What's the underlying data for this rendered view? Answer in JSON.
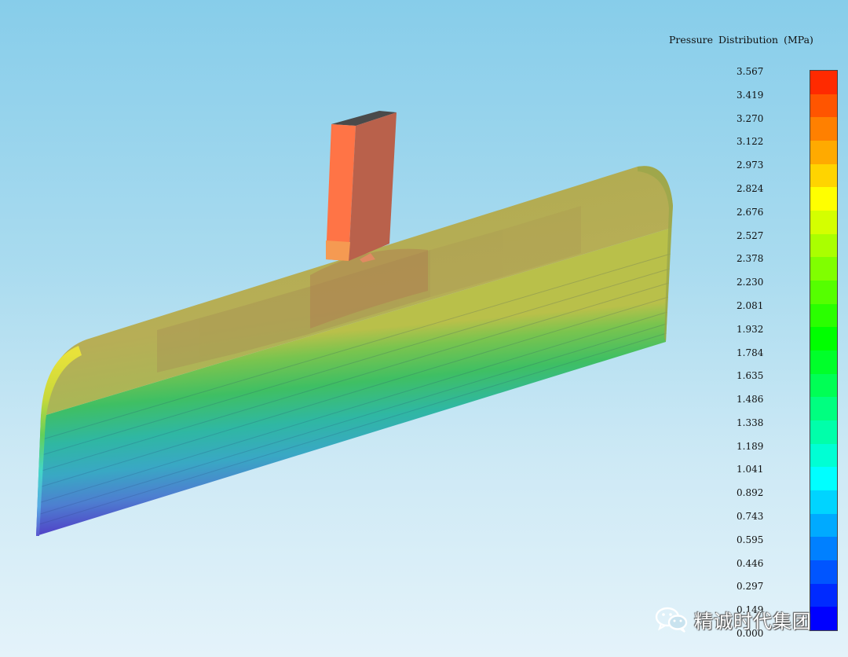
{
  "legend": {
    "title": "Pressure  Distribution (MPa)",
    "ticks": [
      "3.567",
      "3.419",
      "3.270",
      "3.122",
      "2.973",
      "2.824",
      "2.676",
      "2.527",
      "2.378",
      "2.230",
      "2.081",
      "1.932",
      "1.784",
      "1.635",
      "1.486",
      "1.338",
      "1.189",
      "1.041",
      "0.892",
      "0.743",
      "0.595",
      "0.446",
      "0.297",
      "0.149",
      "0.000"
    ],
    "colors": [
      "#ff2a00",
      "#ff5500",
      "#ff8000",
      "#ffaa00",
      "#ffd400",
      "#ffff00",
      "#d4ff00",
      "#aaff00",
      "#80ff00",
      "#55ff00",
      "#2aff00",
      "#00ff00",
      "#00ff2a",
      "#00ff55",
      "#00ff80",
      "#00ffaa",
      "#00ffd4",
      "#00ffff",
      "#00d4ff",
      "#00aaff",
      "#0080ff",
      "#0055ff",
      "#002aff",
      "#0000ff"
    ]
  },
  "watermark": {
    "icon": "wechat-icon",
    "text": "精诚时代集团"
  }
}
